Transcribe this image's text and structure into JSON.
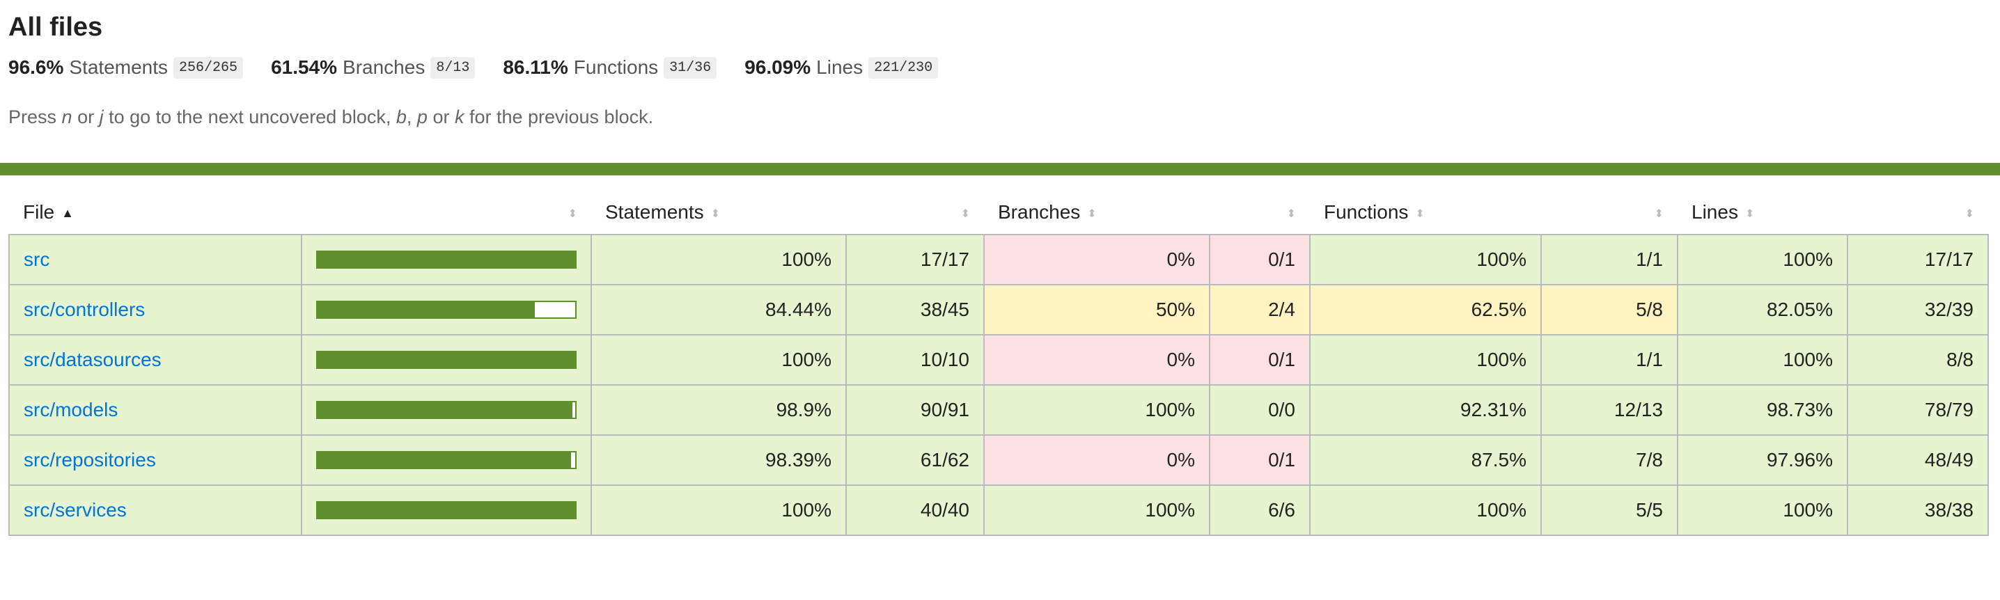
{
  "title": "All files",
  "summary": [
    {
      "pct": "96.6%",
      "label": "Statements",
      "frac": "256/265"
    },
    {
      "pct": "61.54%",
      "label": "Branches",
      "frac": "8/13"
    },
    {
      "pct": "86.11%",
      "label": "Functions",
      "frac": "31/36"
    },
    {
      "pct": "96.09%",
      "label": "Lines",
      "frac": "221/230"
    }
  ],
  "hint": {
    "p1": "Press ",
    "k1": "n",
    "p2": " or ",
    "k2": "j",
    "p3": " to go to the next uncovered block, ",
    "k3": "b",
    "p4": ", ",
    "k4": "p",
    "p5": " or ",
    "k5": "k",
    "p6": " for the previous block."
  },
  "headers": {
    "file": "File",
    "statements": "Statements",
    "branches": "Branches",
    "functions": "Functions",
    "lines": "Lines"
  },
  "colors": {
    "high": "#e6f5d0",
    "low": "#fce1e5",
    "medium": "#fff4c2",
    "bar": "#5f8f2f",
    "link": "#0074d9"
  },
  "rows": [
    {
      "file": "src",
      "bar": 1.0,
      "stmt_pct": "100%",
      "stmt_frac": "17/17",
      "stmt_cls": "high",
      "br_pct": "0%",
      "br_frac": "0/1",
      "br_cls": "low",
      "fn_pct": "100%",
      "fn_frac": "1/1",
      "fn_cls": "high",
      "ln_pct": "100%",
      "ln_frac": "17/17",
      "ln_cls": "high"
    },
    {
      "file": "src/controllers",
      "bar": 0.8444,
      "stmt_pct": "84.44%",
      "stmt_frac": "38/45",
      "stmt_cls": "high",
      "br_pct": "50%",
      "br_frac": "2/4",
      "br_cls": "medium",
      "fn_pct": "62.5%",
      "fn_frac": "5/8",
      "fn_cls": "medium",
      "ln_pct": "82.05%",
      "ln_frac": "32/39",
      "ln_cls": "high"
    },
    {
      "file": "src/datasources",
      "bar": 1.0,
      "stmt_pct": "100%",
      "stmt_frac": "10/10",
      "stmt_cls": "high",
      "br_pct": "0%",
      "br_frac": "0/1",
      "br_cls": "low",
      "fn_pct": "100%",
      "fn_frac": "1/1",
      "fn_cls": "high",
      "ln_pct": "100%",
      "ln_frac": "8/8",
      "ln_cls": "high"
    },
    {
      "file": "src/models",
      "bar": 0.989,
      "stmt_pct": "98.9%",
      "stmt_frac": "90/91",
      "stmt_cls": "high",
      "br_pct": "100%",
      "br_frac": "0/0",
      "br_cls": "high",
      "fn_pct": "92.31%",
      "fn_frac": "12/13",
      "fn_cls": "high",
      "ln_pct": "98.73%",
      "ln_frac": "78/79",
      "ln_cls": "high"
    },
    {
      "file": "src/repositories",
      "bar": 0.9839,
      "stmt_pct": "98.39%",
      "stmt_frac": "61/62",
      "stmt_cls": "high",
      "br_pct": "0%",
      "br_frac": "0/1",
      "br_cls": "low",
      "fn_pct": "87.5%",
      "fn_frac": "7/8",
      "fn_cls": "high",
      "ln_pct": "97.96%",
      "ln_frac": "48/49",
      "ln_cls": "high"
    },
    {
      "file": "src/services",
      "bar": 1.0,
      "stmt_pct": "100%",
      "stmt_frac": "40/40",
      "stmt_cls": "high",
      "br_pct": "100%",
      "br_frac": "6/6",
      "br_cls": "high",
      "fn_pct": "100%",
      "fn_frac": "5/5",
      "fn_cls": "high",
      "ln_pct": "100%",
      "ln_frac": "38/38",
      "ln_cls": "high"
    }
  ]
}
